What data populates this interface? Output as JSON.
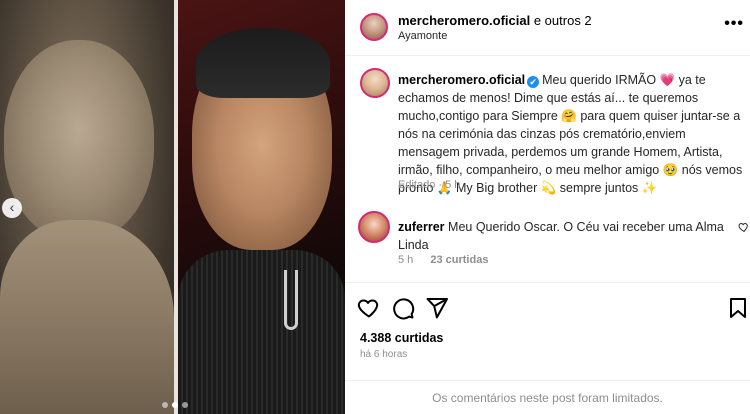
{
  "post": {
    "header": {
      "username": "mercheromero.oficial",
      "coauthors": "e outros 2",
      "location": "Ayamonte",
      "more_label": "•••"
    },
    "caption": {
      "username": "mercheromero.oficial",
      "verified_icon": "✔",
      "text_1": "Meu querido IRMÃO",
      "emoji_1": "💗",
      "text_2": " ya te echamos de menos! Dime que estás aí... te queremos mucho,contigo para Siempre ",
      "emoji_2": "🤗",
      "text_3": " para quem quiser juntar-se a nós na cerimónia das cinzas pós crematório,enviem mensagem privada, perdemos um grande Homem, Artista, irmão, filho, companheiro, o meu melhor amigo ",
      "emoji_3": "🥹",
      "text_4": " nós vemos pronto ",
      "emoji_4": "🙏",
      "text_5": " My Big brother ",
      "emoji_5": "💫",
      "text_6": " sempre juntos ",
      "emoji_6": "✨",
      "edited": "Editado",
      "time": "5 h"
    },
    "comment": {
      "username": "zuferrer",
      "text": "Meu Querido Oscar. O Céu vai receber uma Alma Linda",
      "time": "5 h",
      "likes": "23 curtidas"
    },
    "likes_count": "4.388 curtidas",
    "time_ago": "há 6 horas",
    "comments_limited": "Os comentários neste post foram limitados."
  },
  "carousel": {
    "prev_icon": "chevron-left-icon",
    "prev_glyph": "‹",
    "dots": 3,
    "active_dot": 1
  },
  "colors": {
    "link_blue": "#1f8ef1",
    "meta_gray": "#8e8e8e",
    "story_ring": "#d62976"
  }
}
